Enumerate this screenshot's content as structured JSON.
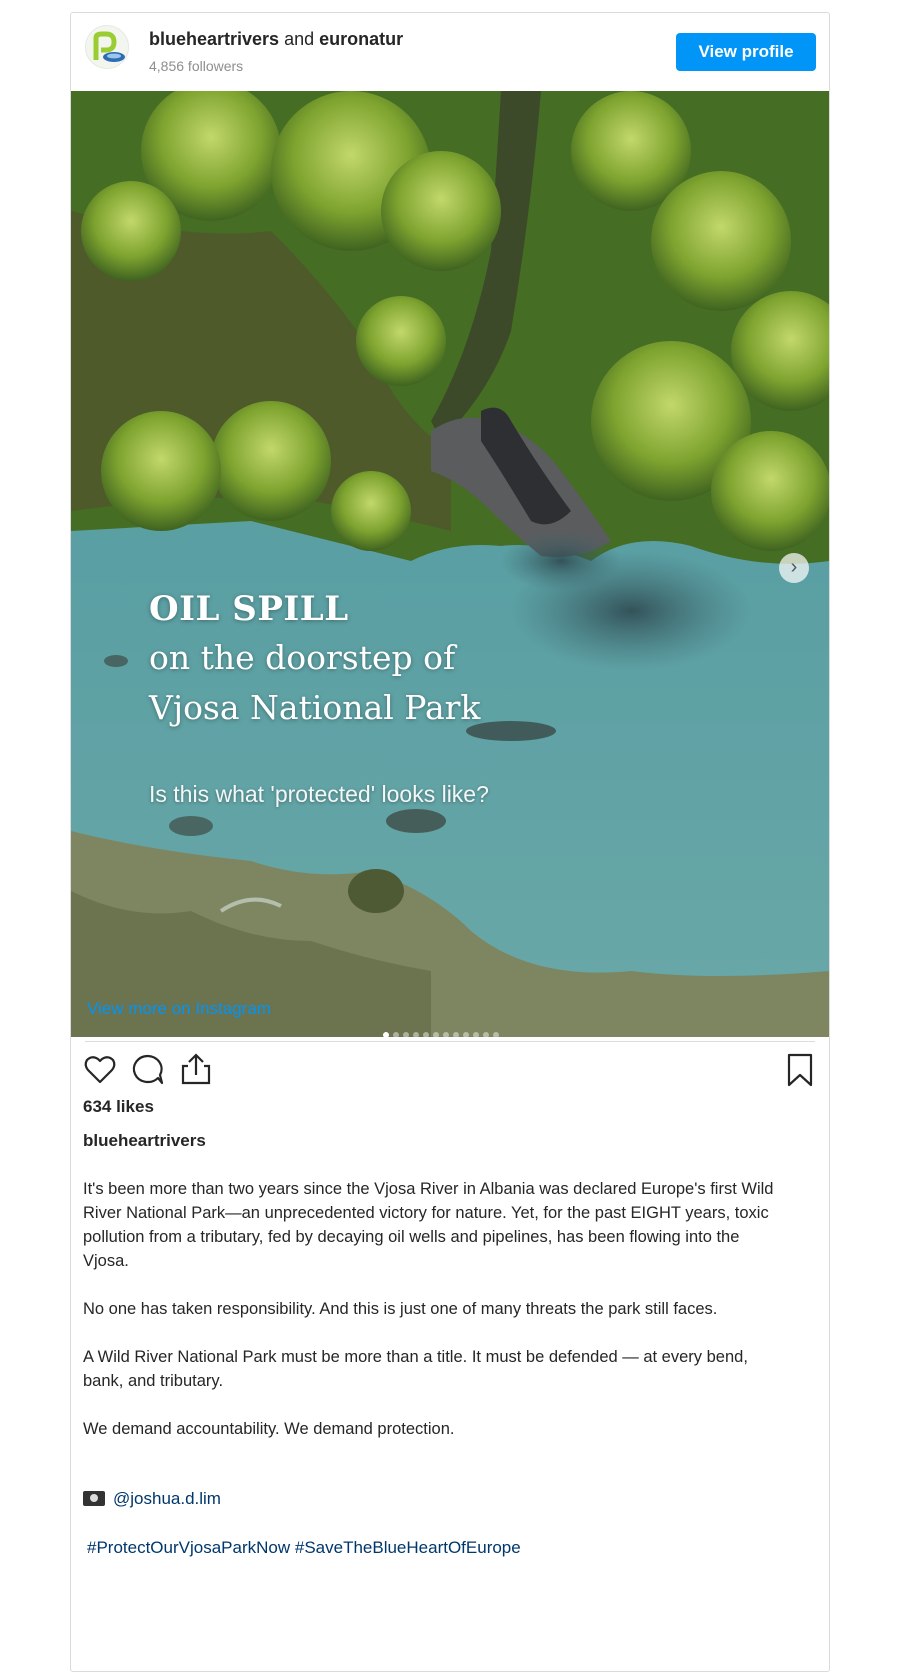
{
  "header": {
    "account_1": "blueheartrivers",
    "joiner": "and",
    "account_2": "euronatur",
    "followers": "4,856 followers",
    "view_profile_label": "View profile"
  },
  "media": {
    "title_line_1": "OIL SPILL",
    "title_line_2": "on the doorstep of",
    "title_line_3": "Vjosa National Park",
    "subtitle": "Is this what 'protected' looks like?",
    "next_icon": "›",
    "carousel_count": 12,
    "carousel_active_index": 0
  },
  "view_more_label": "View more on Instagram",
  "likes": "634 likes",
  "author": "blueheartrivers",
  "caption": [
    "It's been more than two years since the Vjosa River in Albania was declared Europe's first Wild River National Park—an unprecedented victory for nature. Yet, for the past EIGHT years, toxic pollution from a tributary, fed by decaying oil wells and pipelines, has been flowing into the Vjosa.",
    "No one has taken responsibility. And this is just one of many threats the park still faces.",
    "A Wild River National Park must be more than a title. It must be defended — at every bend, bank, and tributary.",
    "We demand accountability. We demand protection."
  ],
  "credit": "@joshua.d.lim",
  "hashtags": "#ProtectOurVjosaParkNow #SaveTheBlueHeartOfEurope",
  "colors": {
    "accent": "#0095f6",
    "link": "#00376b",
    "water": "#5f9ea0"
  }
}
